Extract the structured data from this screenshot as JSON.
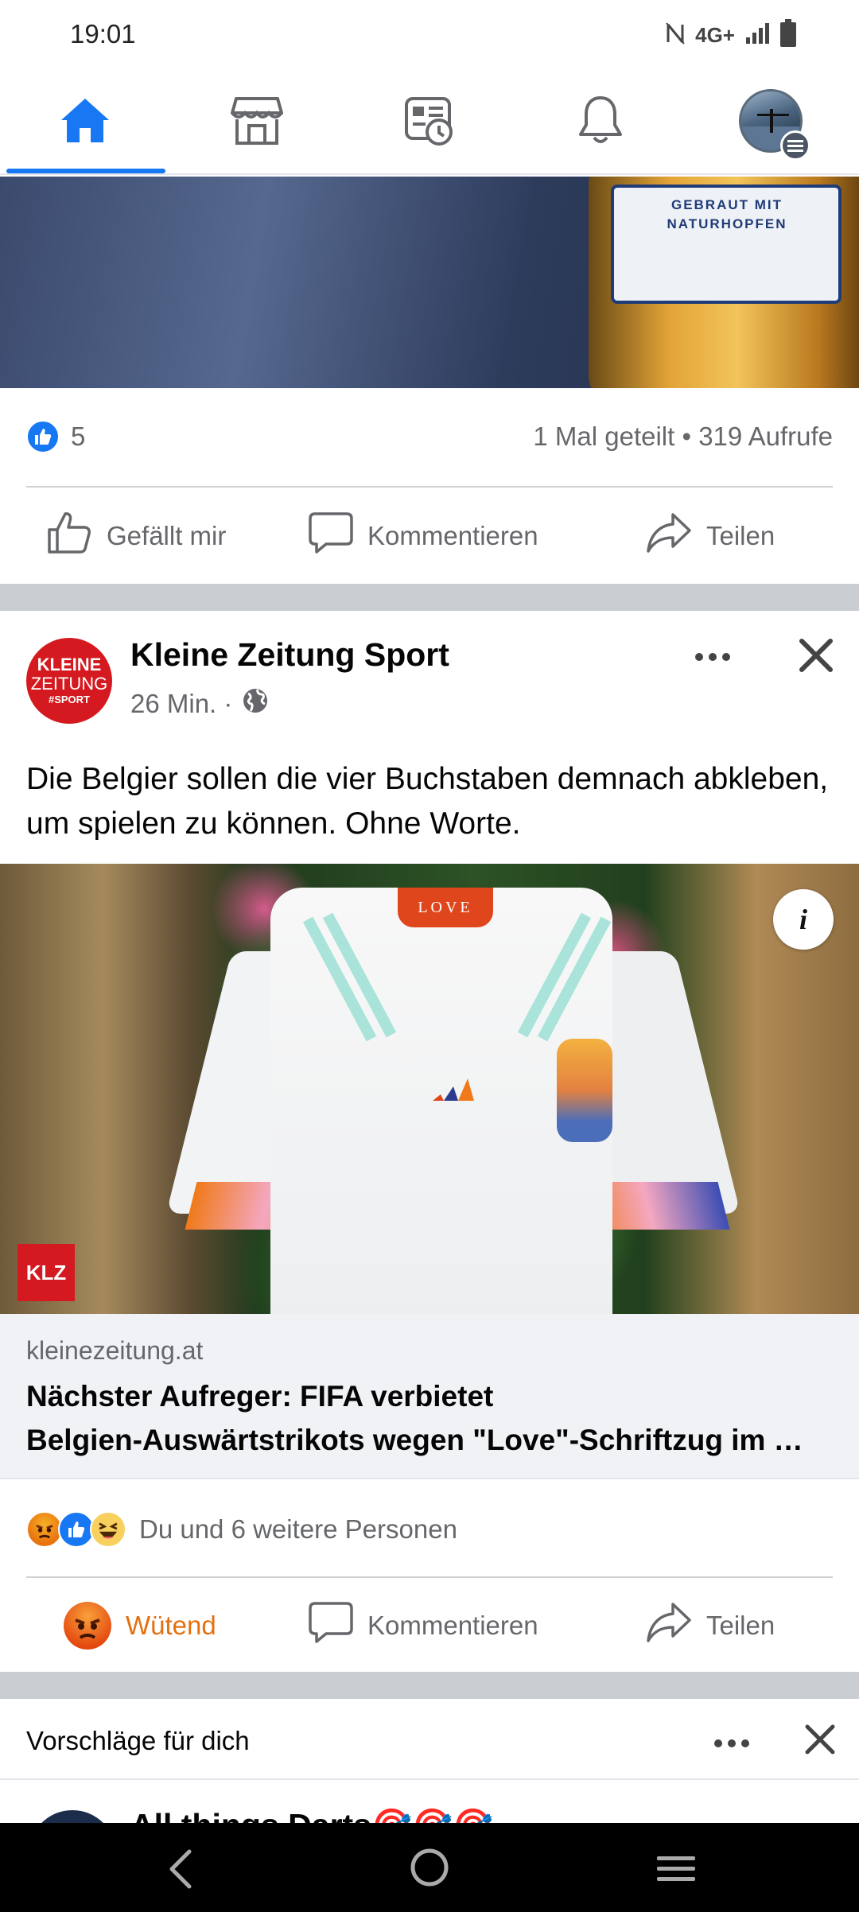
{
  "status_bar": {
    "time": "19:01",
    "network": "4G+"
  },
  "nav": {
    "tabs": [
      {
        "icon": "home-icon",
        "active": true
      },
      {
        "icon": "marketplace-icon",
        "active": false
      },
      {
        "icon": "news-feed-clock-icon",
        "active": false
      },
      {
        "icon": "bell-icon",
        "active": false
      },
      {
        "icon": "profile-avatar",
        "active": false
      }
    ],
    "accent": "#1877f2"
  },
  "previous_post": {
    "image_label": "GEBRAUT MIT NATURHOPFEN",
    "like_count": "5",
    "shares_views": "1 Mal geteilt • 319 Aufrufe",
    "actions": {
      "like": "Gefällt mir",
      "comment": "Kommentieren",
      "share": "Teilen"
    }
  },
  "post": {
    "page_name": "Kleine Zeitung Sport",
    "logo": {
      "line1": "KLEINE",
      "line2": "ZEITUNG",
      "line3": "#SPORT"
    },
    "time": "26 Min. ·",
    "text": "Die Belgier sollen die vier Buchstaben demnach abkleben, um spielen zu können. Ohne Worte.",
    "image": {
      "collar_text": "LOVE",
      "badge": "KLZ",
      "info": "i"
    },
    "link": {
      "domain": "kleinezeitung.at",
      "title_line1": "Nächster Aufreger: FIFA verbietet",
      "title_line2": "Belgien-Auswärtstrikots wegen \"Love\"-Schriftzug im …"
    },
    "reactions_text": "Du und 6 weitere Personen",
    "actions": {
      "react": "Wütend",
      "comment": "Kommentieren",
      "share": "Teilen"
    },
    "react_color": "#e4700f"
  },
  "suggestions": {
    "title": "Vorschläge für dich",
    "next_page_name": "All things Darts🎯🎯🎯"
  }
}
